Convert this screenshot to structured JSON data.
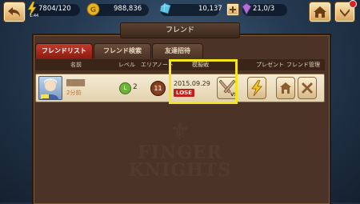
{
  "header": {
    "stamina": "7804/120",
    "stamina_sub": "1:44",
    "gold": "988,836",
    "crystals": "10,137",
    "gems": "21,0/3",
    "back_icon": "back-arrow-icon",
    "home_icon": "home-icon",
    "menu_icon": "menu-chevron-icon"
  },
  "panel": {
    "title": "フレンド",
    "tabs": [
      {
        "label": "フレンドリスト"
      },
      {
        "label": "フレンド検索"
      },
      {
        "label": "友達招待"
      }
    ],
    "columns": {
      "name": "名前",
      "level": "レベル",
      "area": "エリア",
      "note": "ノート",
      "mock_battle": "模擬戦",
      "present": "プレゼント",
      "manage": "フレンド管理"
    },
    "friend": {
      "name": "████",
      "last_login": "2分前",
      "level": "2",
      "area": "11",
      "battle_date": "2015.09.29",
      "battle_result": "LOSE",
      "vs_label": "VS"
    },
    "watermark": {
      "line1": "FINGER",
      "line2": "KNIGHTS"
    }
  },
  "colors": {
    "accent": "#c23a2a",
    "highlight": "#f4e61a",
    "panel": "#4b3427"
  }
}
